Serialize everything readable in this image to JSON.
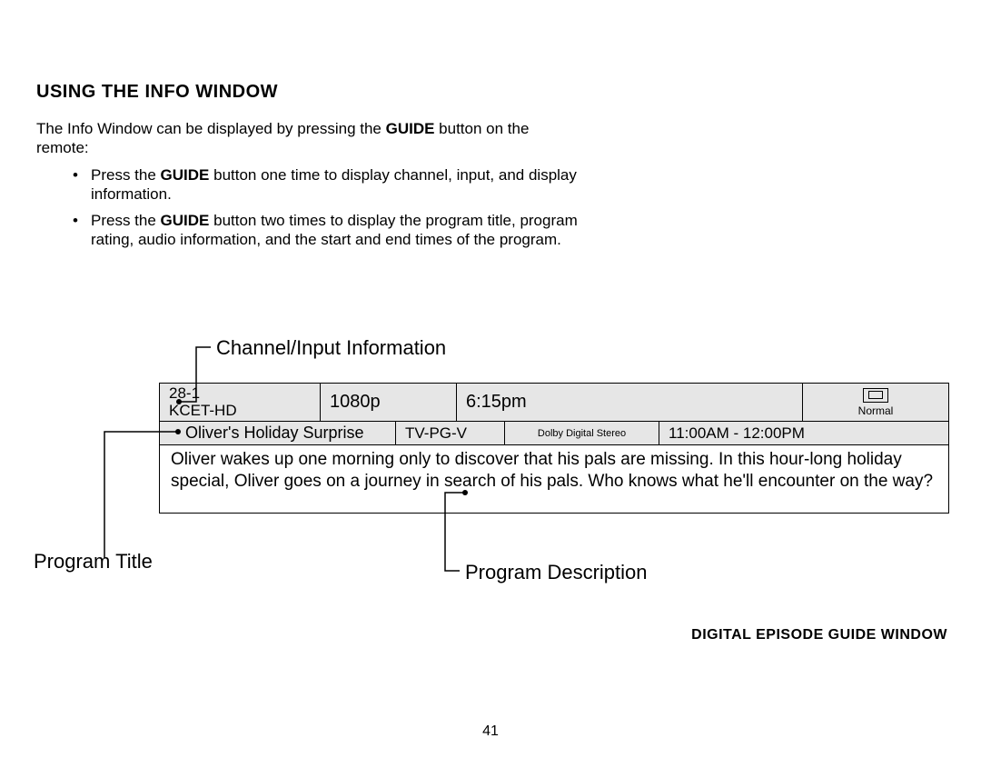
{
  "heading": "USING THE INFO WINDOW",
  "intro_before": "The Info Window can be displayed by pressing the ",
  "guide_word": "GUIDE",
  "intro_after": " button on the remote:",
  "bullets": [
    {
      "pre": "Press the ",
      "bold": "GUIDE",
      "post": " button one time to display channel, input, and display information."
    },
    {
      "pre": "Press the ",
      "bold": "GUIDE",
      "post": " button two times to display the program title, program rating, audio information, and the start and end times of the program."
    }
  ],
  "callouts": {
    "channel": "Channel/Input Information",
    "title": "Program Title",
    "description": "Program Description"
  },
  "info_window": {
    "channel_number": "28-1",
    "channel_name": "KCET-HD",
    "resolution": "1080p",
    "clock": "6:15pm",
    "aspect_label": "Normal",
    "program_title": "Oliver's Holiday Surprise",
    "rating": "TV-PG-V",
    "audio": "Dolby Digital Stereo",
    "time_range": "11:00AM - 12:00PM",
    "description": "Oliver wakes up one morning only to discover that his pals are missing. In this hour-long holiday special, Oliver goes on a journey in search of his pals. Who knows what he'll encounter on the way?"
  },
  "caption": "DIGITAL EPISODE GUIDE WINDOW",
  "page_number": "41"
}
